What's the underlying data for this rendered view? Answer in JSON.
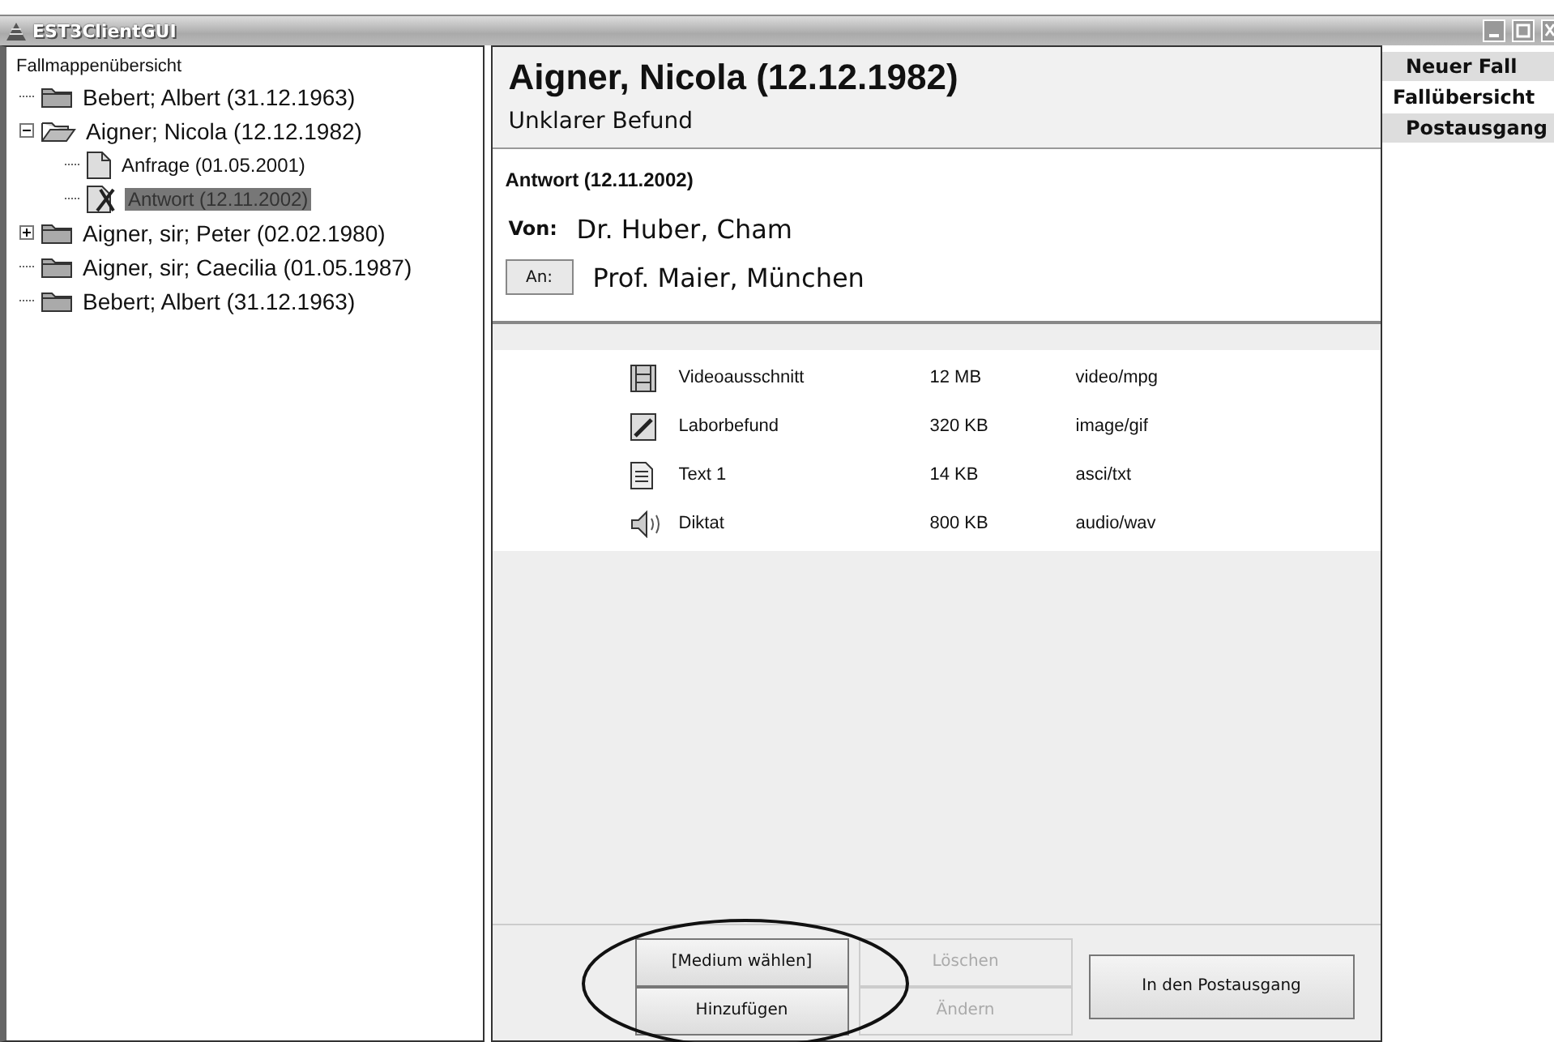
{
  "window": {
    "title": "EST3ClientGUI"
  },
  "tree": {
    "title": "Fallmappenübersicht",
    "items": [
      {
        "label": "Bebert; Albert (31.12.1963)",
        "kind": "folder",
        "expanded": false,
        "selected": false
      },
      {
        "label": "Aigner; Nicola (12.12.1982)",
        "kind": "folder",
        "expanded": true,
        "selected": false,
        "children": [
          {
            "label": "Anfrage (01.05.2001)",
            "kind": "document",
            "selected": false
          },
          {
            "label": "Antwort (12.11.2002)",
            "kind": "reply",
            "selected": true
          }
        ]
      },
      {
        "label": "Aigner, sir; Peter (02.02.1980)",
        "kind": "folder",
        "expanded": false,
        "has_children": true,
        "selected": false
      },
      {
        "label": "Aigner, sir; Caecilia (01.05.1987)",
        "kind": "folder",
        "expanded": false,
        "selected": false
      },
      {
        "label": "Bebert; Albert (31.12.1963)",
        "kind": "folder",
        "expanded": false,
        "selected": false
      }
    ]
  },
  "header": {
    "title": "Aigner, Nicola (12.12.1982)",
    "subtitle": "Unklarer Befund"
  },
  "message": {
    "title": "Antwort (12.11.2002)",
    "from_label": "Von:",
    "from": "Dr. Huber, Cham",
    "to_button": "An:",
    "to": "Prof. Maier, München"
  },
  "attachments": [
    {
      "kind": "video",
      "name": "Videoausschnitt",
      "size": "12 MB",
      "type": "video/mpg"
    },
    {
      "kind": "image",
      "name": "Laborbefund",
      "size": "320 KB",
      "type": "image/gif"
    },
    {
      "kind": "text",
      "name": "Text 1",
      "size": "14 KB",
      "type": "asci/txt"
    },
    {
      "kind": "audio",
      "name": "Diktat",
      "size": "800 KB",
      "type": "audio/wav"
    }
  ],
  "buttons": [
    {
      "label": "[Medium wählen]",
      "disabled": false
    },
    {
      "label": "Hinzufügen",
      "disabled": false
    },
    {
      "label": "Löschen",
      "disabled": true
    },
    {
      "label": "Ändern",
      "disabled": true
    },
    {
      "label": "In den Postausgang",
      "disabled": false
    }
  ],
  "sidebar": [
    {
      "label": "Neuer Fall",
      "selected": false
    },
    {
      "label": "Fallübersicht",
      "selected": true
    },
    {
      "label": "Postausgang",
      "selected": false
    }
  ]
}
